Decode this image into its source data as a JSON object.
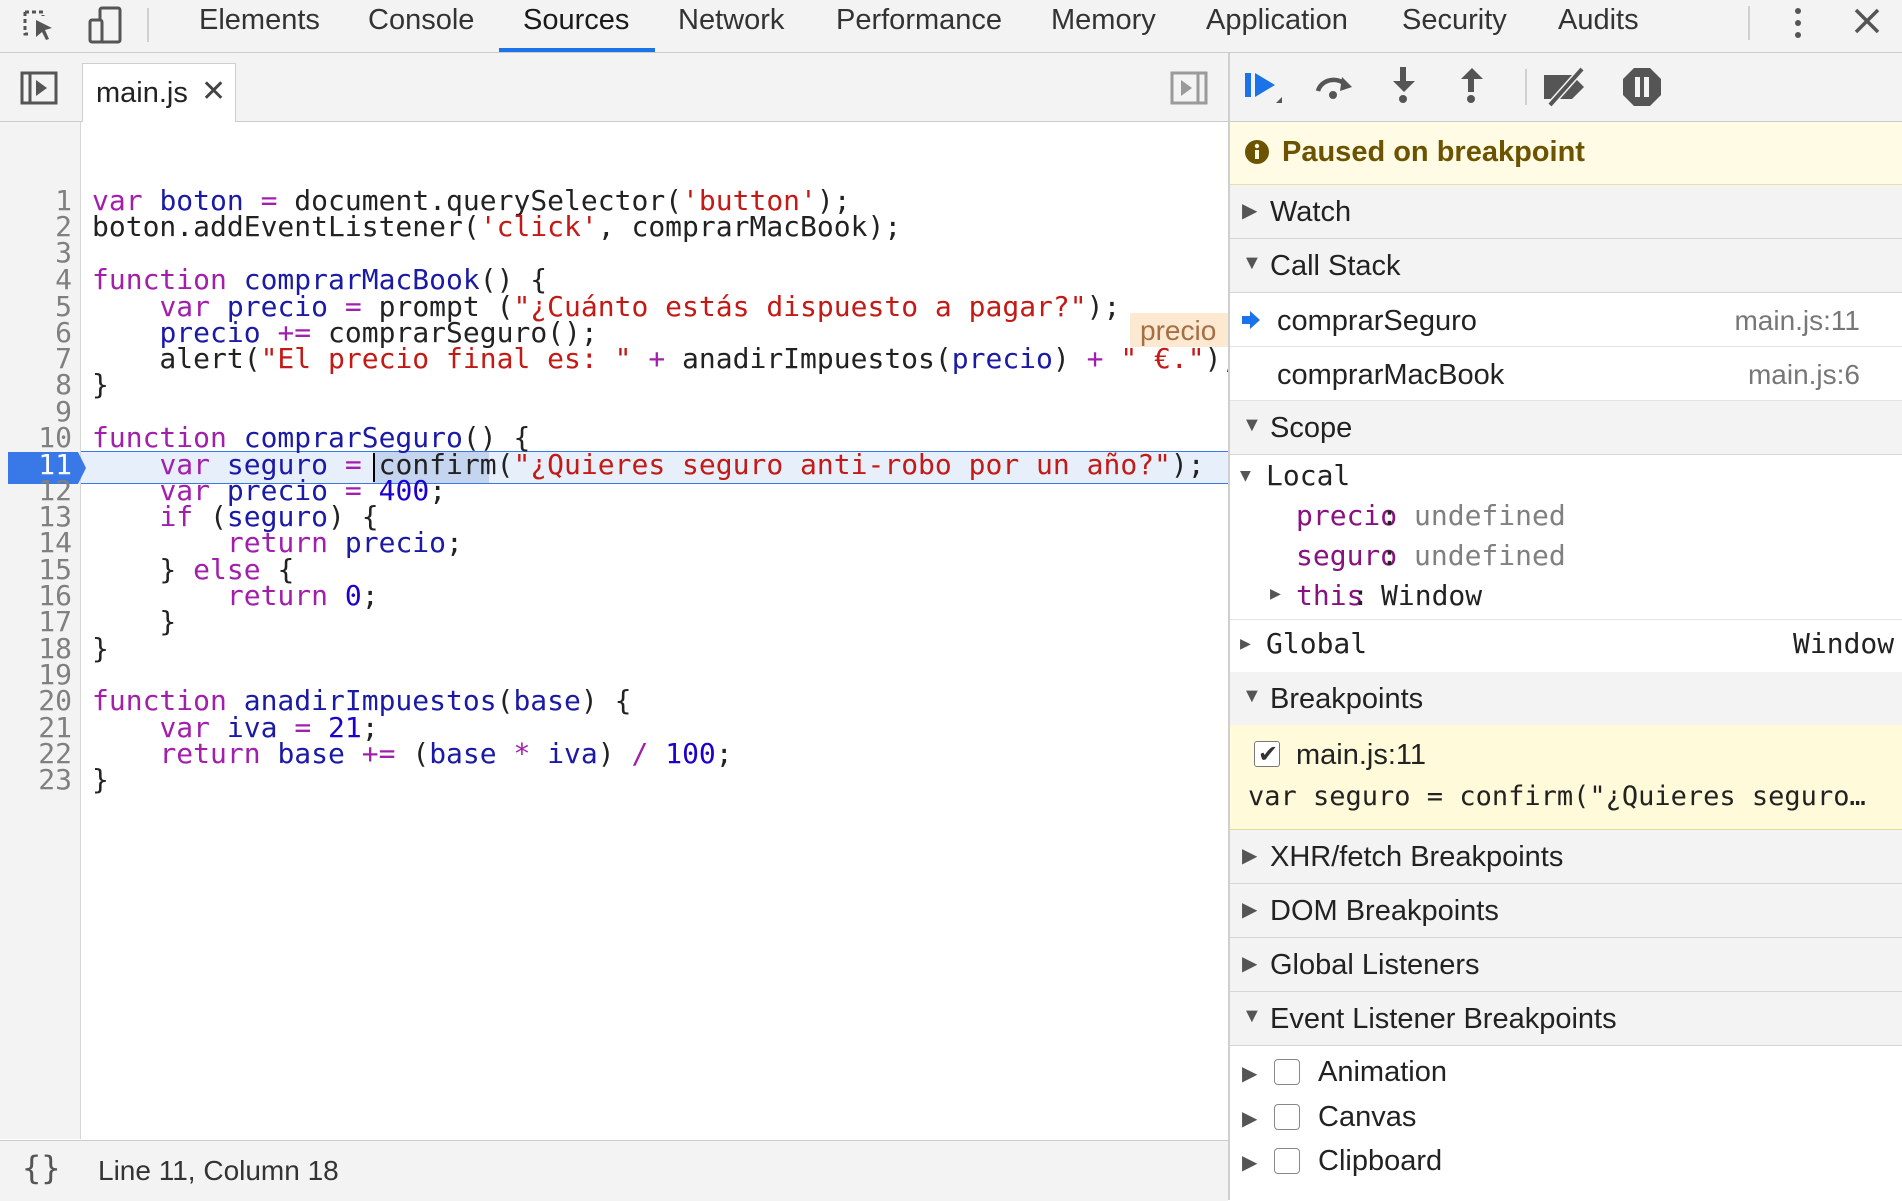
{
  "toolbar": {
    "tabs": [
      "Elements",
      "Console",
      "Sources",
      "Network",
      "Performance",
      "Memory",
      "Application",
      "Security",
      "Audits"
    ],
    "active_tab": "Sources"
  },
  "editor": {
    "file_tab": "main.js",
    "close_glyph": "✕",
    "execution_line": 11,
    "inline_value": "precio",
    "status": "Line 11, Column 18",
    "braces_icon": "{}",
    "line_numbers": [
      "1",
      "2",
      "3",
      "4",
      "5",
      "6",
      "7",
      "8",
      "9",
      "10",
      "11",
      "12",
      "13",
      "14",
      "15",
      "16",
      "17",
      "18",
      "19",
      "20",
      "21",
      "22",
      "23"
    ]
  },
  "debugger": {
    "paused_text": "Paused on breakpoint",
    "watch_label": "Watch",
    "callstack_label": "Call Stack",
    "callstack": [
      {
        "name": "comprarSeguro",
        "location": "main.js:11"
      },
      {
        "name": "comprarMacBook",
        "location": "main.js:6"
      }
    ],
    "scope_label": "Scope",
    "local_label": "Local",
    "scope_vars": [
      {
        "name": "precio",
        "value": "undefined"
      },
      {
        "name": "seguro",
        "value": "undefined"
      }
    ],
    "this_name": "this",
    "this_value": "Window",
    "global_label": "Global",
    "global_value": "Window",
    "breakpoints_label": "Breakpoints",
    "breakpoint": {
      "location": "main.js:11",
      "snippet": "var seguro = confirm(\"¿Quieres seguro…"
    },
    "xhr_label": "XHR/fetch Breakpoints",
    "dom_label": "DOM Breakpoints",
    "global_listeners_label": "Global Listeners",
    "event_listener_label": "Event Listener Breakpoints",
    "event_listeners": [
      "Animation",
      "Canvas",
      "Clipboard"
    ]
  },
  "colors": {
    "accent": "#1a73e8",
    "keyword": "#a21fac",
    "string": "#c41a16",
    "number": "#1c00cf",
    "paused_banner": "#fffbe5"
  }
}
